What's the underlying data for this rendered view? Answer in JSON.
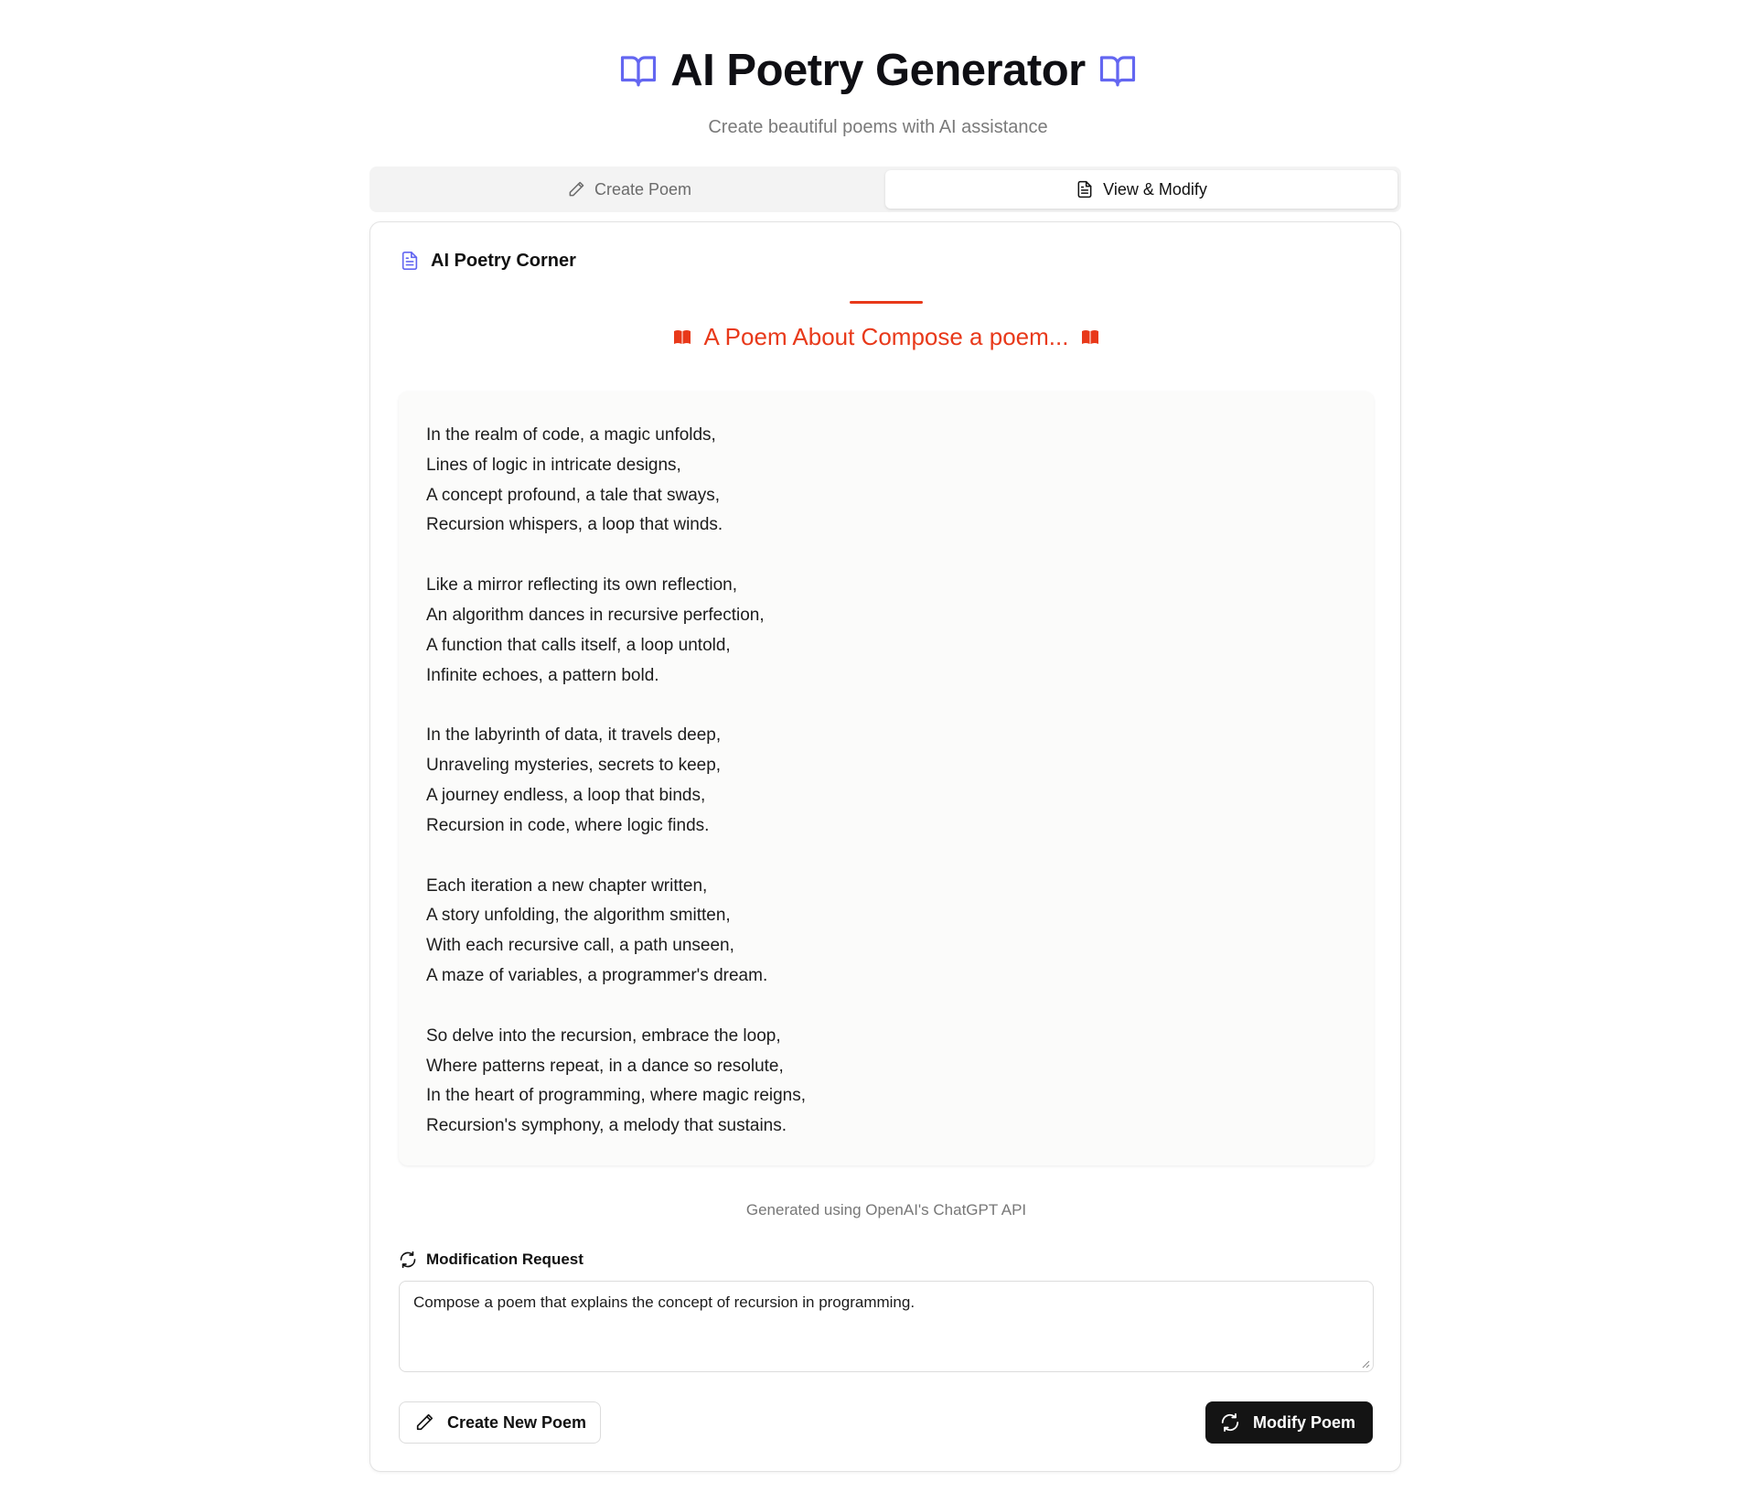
{
  "header": {
    "title": "AI Poetry Generator",
    "subtitle": "Create beautiful poems with AI assistance",
    "left_icon": "book-open-icon",
    "right_icon": "book-open-icon"
  },
  "tabs": [
    {
      "label": "Create Poem",
      "icon": "pencil-icon",
      "active": false
    },
    {
      "label": "View & Modify",
      "icon": "document-icon",
      "active": true
    }
  ],
  "card": {
    "header_label": "AI Poetry Corner",
    "header_icon": "document-icon",
    "poem_title": "A Poem About Compose a poem...",
    "poem_title_icon": "book-icon",
    "stanzas": [
      [
        "In the realm of code, a magic unfolds,",
        "Lines of logic in intricate designs,",
        "A concept profound, a tale that sways,",
        "Recursion whispers, a loop that winds."
      ],
      [
        "Like a mirror reflecting its own reflection,",
        "An algorithm dances in recursive perfection,",
        "A function that calls itself, a loop untold,",
        "Infinite echoes, a pattern bold."
      ],
      [
        "In the labyrinth of data, it travels deep,",
        "Unraveling mysteries, secrets to keep,",
        "A journey endless, a loop that binds,",
        "Recursion in code, where logic finds."
      ],
      [
        "Each iteration a new chapter written,",
        "A story unfolding, the algorithm smitten,",
        "With each recursive call, a path unseen,",
        "A maze of variables, a programmer's dream."
      ],
      [
        "So delve into the recursion, embrace the loop,",
        "Where patterns repeat, in a dance so resolute,",
        "In the heart of programming, where magic reigns,",
        "Recursion's symphony, a melody that sustains."
      ]
    ],
    "credit": "Generated using OpenAI's ChatGPT API",
    "modification": {
      "label": "Modification Request",
      "icon": "refresh-icon",
      "value": "Compose a poem that explains the concept of recursion in programming."
    },
    "buttons": {
      "create_new": {
        "label": "Create New Poem",
        "icon": "pencil-icon"
      },
      "modify": {
        "label": "Modify Poem",
        "icon": "refresh-icon"
      }
    }
  },
  "colors": {
    "accent": "#e8391a",
    "brand_icon": "#6366f1",
    "primary_button": "#141414"
  }
}
